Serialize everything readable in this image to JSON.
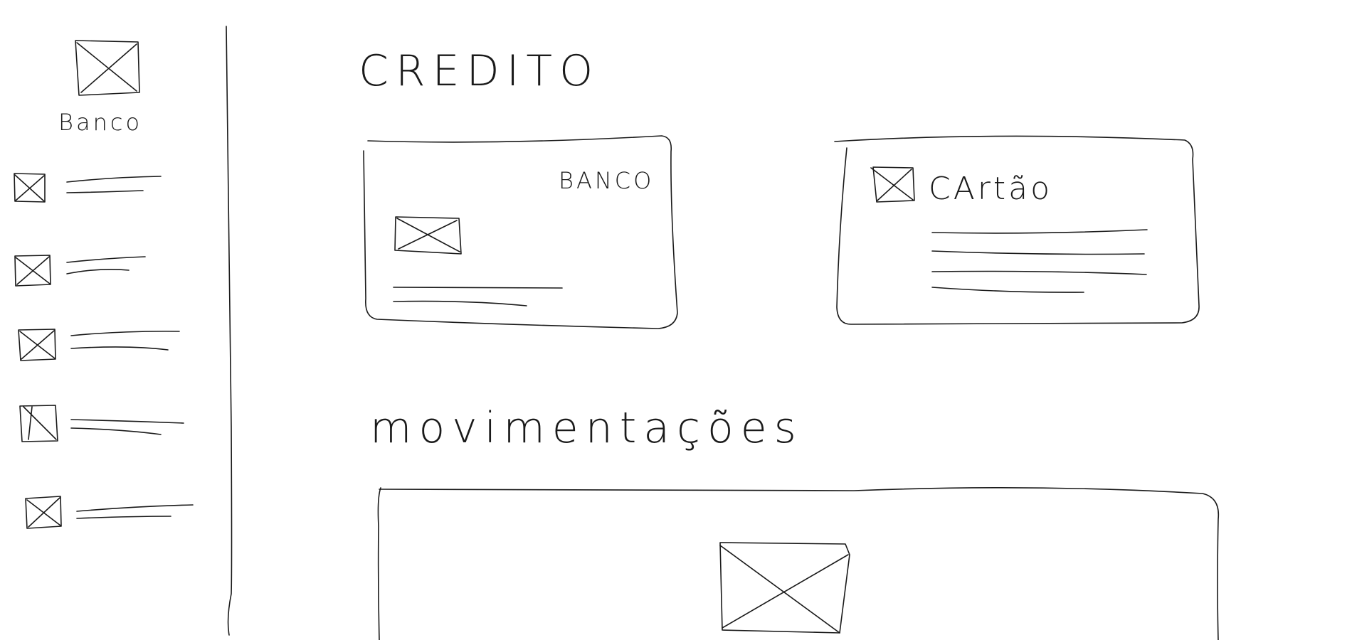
{
  "sidebar": {
    "brand_label": "Banco",
    "items": [
      {
        "icon": "placeholder-image-icon"
      },
      {
        "icon": "placeholder-image-icon"
      },
      {
        "icon": "placeholder-image-icon"
      },
      {
        "icon": "placeholder-image-icon"
      },
      {
        "icon": "placeholder-image-icon"
      }
    ]
  },
  "main": {
    "title": "CREDITO",
    "bank_card": {
      "label": "BANCO",
      "icon": "placeholder-image-icon"
    },
    "card_panel": {
      "title": "CArtão",
      "icon": "placeholder-image-icon"
    },
    "movements": {
      "title": "movimentações",
      "icon": "placeholder-image-icon"
    }
  },
  "colors": {
    "ink": "#1a1a1a",
    "background": "#ffffff"
  }
}
